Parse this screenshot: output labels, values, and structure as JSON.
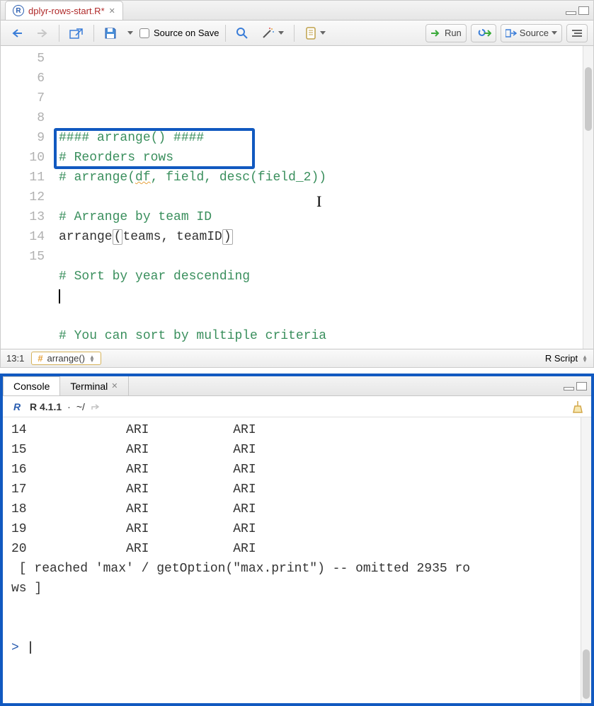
{
  "file_tab": {
    "name": "dplyr-rows-start.R*"
  },
  "toolbar": {
    "source_on_save": "Source on Save",
    "run": "Run",
    "source": "Source"
  },
  "code": {
    "lines": [
      {
        "n": 5,
        "text": "#### arrange() ####",
        "cls": "comment"
      },
      {
        "n": 6,
        "text": "# Reorders rows",
        "cls": "comment"
      },
      {
        "n": 7,
        "text_parts": [
          {
            "t": "# arrange(",
            "cls": "comment"
          },
          {
            "t": "df",
            "cls": "comment underline-wavy"
          },
          {
            "t": ", field, desc(field_2))",
            "cls": "comment"
          }
        ]
      },
      {
        "n": 8,
        "text": " "
      },
      {
        "n": 9,
        "text": "# Arrange by team ID",
        "cls": "comment"
      },
      {
        "n": 10,
        "text_parts": [
          {
            "t": "arrange"
          },
          {
            "t": "(",
            "cls": "paren-hl"
          },
          {
            "t": "teams, teamID"
          },
          {
            "t": ")",
            "cls": "paren-hl"
          }
        ]
      },
      {
        "n": 11,
        "text": " "
      },
      {
        "n": 12,
        "text": "# Sort by year descending",
        "cls": "comment"
      },
      {
        "n": 13,
        "text_parts": [
          {
            "t": "",
            "cls": "cursor-char"
          }
        ]
      },
      {
        "n": 14,
        "text": " "
      },
      {
        "n": 15,
        "text": "# You can sort by multiple criteria",
        "cls": "comment"
      }
    ]
  },
  "status": {
    "pos": "13:1",
    "section": "arrange()",
    "lang": "R Script"
  },
  "console": {
    "tab_console": "Console",
    "tab_terminal": "Terminal",
    "version": "R 4.1.1",
    "cwd": "~/",
    "rows": [
      {
        "n": "14",
        "a": "ARI",
        "b": "ARI"
      },
      {
        "n": "15",
        "a": "ARI",
        "b": "ARI"
      },
      {
        "n": "16",
        "a": "ARI",
        "b": "ARI"
      },
      {
        "n": "17",
        "a": "ARI",
        "b": "ARI"
      },
      {
        "n": "18",
        "a": "ARI",
        "b": "ARI"
      },
      {
        "n": "19",
        "a": "ARI",
        "b": "ARI"
      },
      {
        "n": "20",
        "a": "ARI",
        "b": "ARI"
      }
    ],
    "trailer": " [ reached 'max' / getOption(\"max.print\") -- omitted 2935 ro\nws ]",
    "prompt": ">"
  }
}
